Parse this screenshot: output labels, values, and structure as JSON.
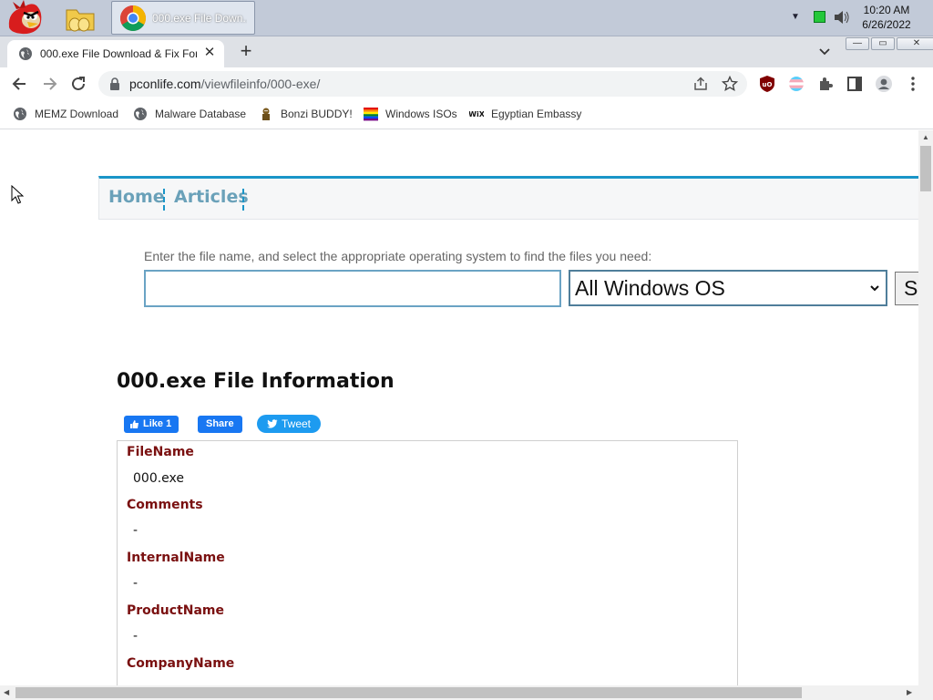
{
  "taskbar": {
    "task_label": "000.exe File Down...",
    "clock_time": "10:20 AM",
    "clock_date": "6/26/2022"
  },
  "browser": {
    "tab_title": "000.exe File Download & Fix For",
    "url_host": "pconlife.com",
    "url_path": "/viewfileinfo/000-exe/",
    "bookmarks": [
      {
        "label": "MEMZ Download",
        "icon": "globe-icon"
      },
      {
        "label": "Malware Database",
        "icon": "globe-icon"
      },
      {
        "label": "Bonzi BUDDY!",
        "icon": "bonzi-icon"
      },
      {
        "label": "Windows ISOs",
        "icon": "rainbow-flag-icon"
      },
      {
        "label": "Egyptian Embassy",
        "icon": "wix-icon"
      }
    ]
  },
  "site": {
    "nav": [
      "Home",
      "Articles"
    ],
    "prompt": "Enter the file name, and select the appropriate operating system to find the files you need:",
    "search_value": "",
    "os_selected": "All Windows OS",
    "search_button": "S",
    "heading": "000.exe File Information",
    "like_label": "Like 1",
    "share_label": "Share",
    "tweet_label": "Tweet",
    "fields": [
      {
        "label": "FileName",
        "value": "000.exe"
      },
      {
        "label": "Comments",
        "value": "-"
      },
      {
        "label": "InternalName",
        "value": "-"
      },
      {
        "label": "ProductName",
        "value": "-"
      },
      {
        "label": "CompanyName",
        "value": ""
      }
    ]
  },
  "colors": {
    "accent_blue": "#1a95c8",
    "field_label": "#7a1010",
    "nav_text": "#6aa1b9"
  }
}
